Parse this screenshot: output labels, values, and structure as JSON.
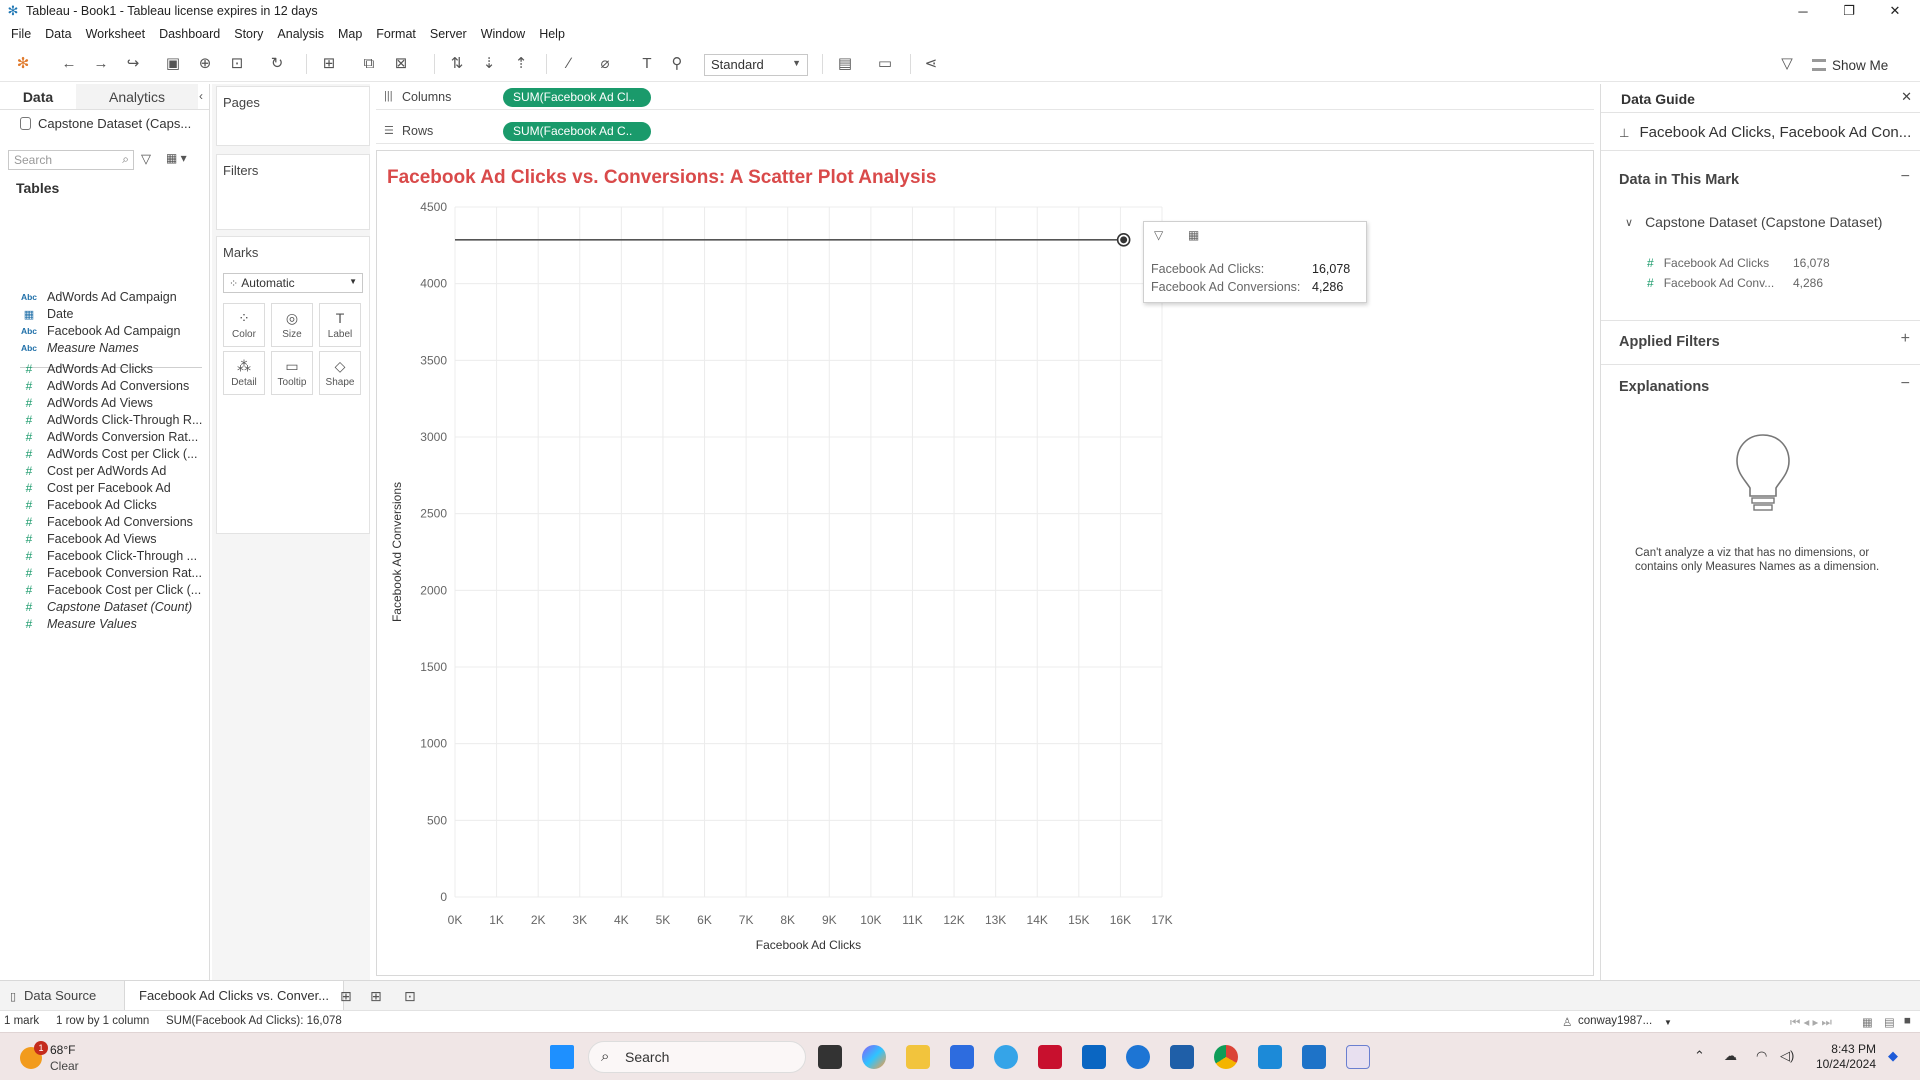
{
  "window": {
    "title": "Tableau - Book1 - Tableau license expires in 12 days",
    "minimize_glyph": "─",
    "restore_glyph": "❐",
    "close_glyph": "✕"
  },
  "menu": [
    "File",
    "Data",
    "Worksheet",
    "Dashboard",
    "Story",
    "Analysis",
    "Map",
    "Format",
    "Server",
    "Window",
    "Help"
  ],
  "toolbar": {
    "fit_value": "Standard",
    "show_me_label": "Show Me"
  },
  "data_pane": {
    "tabs": [
      "Data",
      "Analytics"
    ],
    "datasource": "Capstone Dataset (Caps...",
    "search_placeholder": "Search",
    "tables_heading": "Tables",
    "fields": [
      {
        "type": "dim",
        "label": "AdWords Ad Campaign"
      },
      {
        "type": "date",
        "label": "Date"
      },
      {
        "type": "dim",
        "label": "Facebook Ad Campaign"
      },
      {
        "type": "dim",
        "label": "Measure Names",
        "italic": true
      },
      {
        "type": "meas",
        "label": "AdWords Ad Clicks"
      },
      {
        "type": "meas",
        "label": "AdWords Ad Conversions"
      },
      {
        "type": "meas",
        "label": "AdWords Ad Views"
      },
      {
        "type": "meas",
        "label": "AdWords Click-Through R..."
      },
      {
        "type": "meas",
        "label": "AdWords Conversion Rat..."
      },
      {
        "type": "meas",
        "label": "AdWords Cost per Click (..."
      },
      {
        "type": "meas",
        "label": "Cost per AdWords Ad"
      },
      {
        "type": "meas",
        "label": "Cost per Facebook Ad"
      },
      {
        "type": "meas",
        "label": "Facebook Ad Clicks"
      },
      {
        "type": "meas",
        "label": "Facebook Ad Conversions"
      },
      {
        "type": "meas",
        "label": "Facebook Ad Views"
      },
      {
        "type": "meas",
        "label": "Facebook Click-Through ..."
      },
      {
        "type": "meas",
        "label": "Facebook Conversion Rat..."
      },
      {
        "type": "meas",
        "label": "Facebook Cost per Click (..."
      },
      {
        "type": "meas",
        "label": "Capstone Dataset (Count)",
        "italic": true
      },
      {
        "type": "meas",
        "label": "Measure Values",
        "italic": true
      }
    ],
    "field_glyphs": {
      "dim": "Abc",
      "date": "▦",
      "meas": "#"
    }
  },
  "cards": {
    "pages": "Pages",
    "filters": "Filters",
    "marks": "Marks",
    "mark_type": "Automatic",
    "mark_buttons": [
      {
        "label": "Color",
        "icon": "color-icon",
        "glyph": "⁘"
      },
      {
        "label": "Size",
        "icon": "size-icon",
        "glyph": "◎"
      },
      {
        "label": "Label",
        "icon": "label-icon",
        "glyph": "T"
      },
      {
        "label": "Detail",
        "icon": "detail-icon",
        "glyph": "⁂"
      },
      {
        "label": "Tooltip",
        "icon": "tooltip-icon",
        "glyph": "▭"
      },
      {
        "label": "Shape",
        "icon": "shape-icon",
        "glyph": "◇"
      }
    ]
  },
  "shelves": {
    "columns_label": "Columns",
    "columns_pill": "SUM(Facebook Ad Cl..",
    "rows_label": "Rows",
    "rows_pill": "SUM(Facebook Ad C.."
  },
  "chart_data": {
    "type": "scatter",
    "title": "Facebook Ad Clicks vs. Conversions: A Scatter Plot Analysis",
    "xlabel": "Facebook Ad Clicks",
    "ylabel": "Facebook Ad Conversions",
    "x_ticks": [
      "0K",
      "1K",
      "2K",
      "3K",
      "4K",
      "5K",
      "6K",
      "7K",
      "8K",
      "9K",
      "10K",
      "11K",
      "12K",
      "13K",
      "14K",
      "15K",
      "16K",
      "17K"
    ],
    "y_ticks": [
      "0",
      "500",
      "1000",
      "1500",
      "2000",
      "2500",
      "3000",
      "3500",
      "4000",
      "4500"
    ],
    "xlim": [
      0,
      17000
    ],
    "ylim": [
      0,
      4500
    ],
    "grid": true,
    "points": [
      {
        "x": 16078,
        "y": 4286
      }
    ],
    "title_color": "#d94a4a",
    "mark_color": "#333333"
  },
  "tooltip": {
    "rows": [
      {
        "label": "Facebook Ad Clicks:",
        "value": "16,078"
      },
      {
        "label": "Facebook Ad Conversions:",
        "value": "4,286"
      }
    ]
  },
  "data_guide": {
    "heading": "Data Guide",
    "subject": "Facebook Ad Clicks, Facebook Ad Con...",
    "sections": {
      "data_in_mark": "Data in This Mark",
      "applied_filters": "Applied Filters",
      "explanations": "Explanations"
    },
    "datasource": "Capstone Dataset (Capstone Dataset)",
    "mark_fields": [
      {
        "label": "Facebook Ad Clicks",
        "value": "16,078"
      },
      {
        "label": "Facebook Ad Conv...",
        "value": "4,286"
      }
    ],
    "explain_text": "Can't analyze a viz that has no dimensions, or contains only Measures Names as a dimension."
  },
  "sheets": {
    "data_source": "Data Source",
    "active": "Facebook Ad Clicks vs. Conver..."
  },
  "status": {
    "marks": "1 mark",
    "dims": "1 row by 1 column",
    "sum": "SUM(Facebook Ad Clicks): 16,078",
    "user": "conway1987..."
  },
  "taskbar": {
    "weather_temp": "68°F",
    "weather_cond": "Clear",
    "weather_badge": "1",
    "search_label": "Search",
    "time": "8:43 PM",
    "date": "10/24/2024"
  }
}
